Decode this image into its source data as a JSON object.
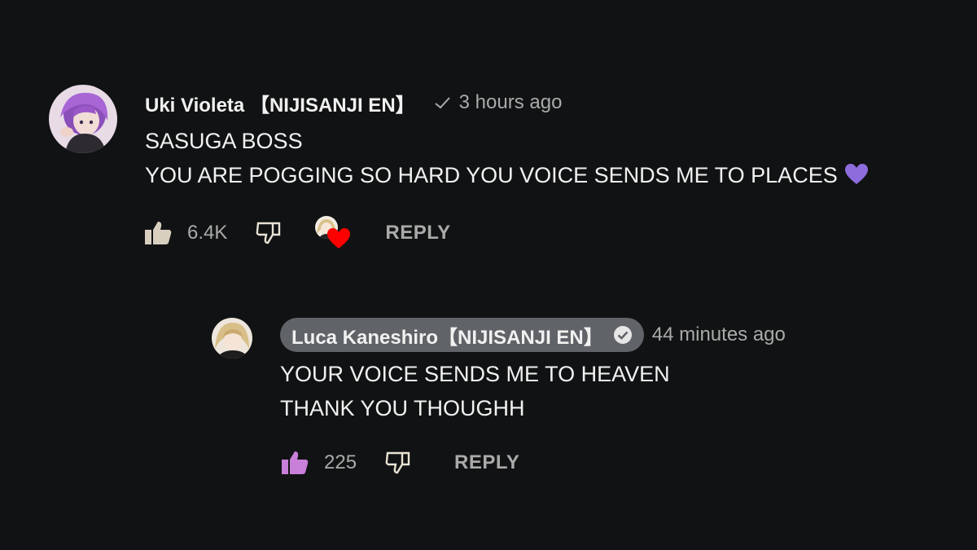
{
  "comments": [
    {
      "author": "Uki Violeta 【NIJISANJI EN】",
      "time": "3 hours ago",
      "lines": [
        "SASUGA BOSS",
        "YOU ARE POGGING SO HARD YOU VOICE SENDS ME TO PLACES"
      ],
      "emoji": "purple-heart",
      "likes": "6.4K",
      "reply_label": "REPLY",
      "hearted_by_creator": true
    },
    {
      "author": "Luca Kaneshiro【NIJISANJI EN】",
      "time": "44 minutes ago",
      "lines": [
        "YOUR VOICE SENDS ME TO HEAVEN",
        "THANK YOU THOUGHH"
      ],
      "likes": "225",
      "reply_label": "REPLY",
      "liked": true
    }
  ],
  "colors": {
    "background": "#111213",
    "muted_text": "#aaaaaa",
    "owner_pill": "#606367",
    "liked_thumb": "#c77fd8",
    "heart_red": "#ff0000",
    "purple_heart": "#8c6ddb"
  },
  "icons": [
    "check-icon",
    "verified-icon",
    "like-icon",
    "dislike-icon",
    "creator-heart-icon",
    "purple-heart-emoji"
  ]
}
